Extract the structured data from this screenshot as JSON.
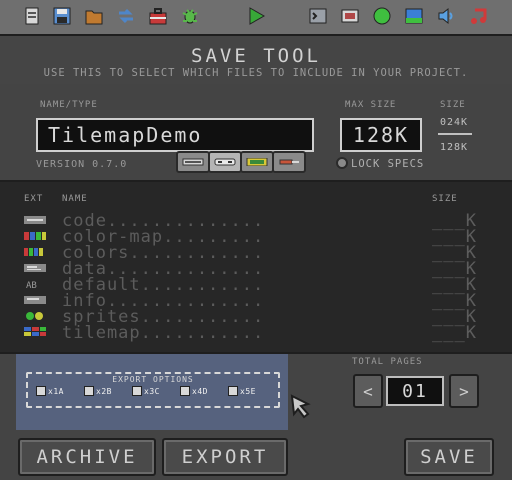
{
  "toolbar": {
    "buttons": [
      {
        "name": "new-file-icon",
        "color": "#d8d8d8"
      },
      {
        "name": "save-disk-icon",
        "color": "#5a8fd0"
      },
      {
        "name": "folder-icon",
        "color": "#c07a30"
      },
      {
        "name": "swap-icon",
        "color": "#4f86c8"
      },
      {
        "name": "toolbox-icon",
        "color": "#c83a3a"
      },
      {
        "name": "bug-icon",
        "color": "#58b84a"
      },
      {
        "name": "play-icon",
        "color": "#38a838"
      },
      {
        "name": "terminal-icon",
        "color": "#9aa0a8"
      },
      {
        "name": "tile-editor-icon",
        "color": "#b04848"
      },
      {
        "name": "sprite-icon",
        "color": "#3fbf3f"
      },
      {
        "name": "map-icon",
        "color": "#3b7fd6"
      },
      {
        "name": "sound-icon",
        "color": "#5aa0e0"
      },
      {
        "name": "music-icon",
        "color": "#d03a3a"
      }
    ]
  },
  "header": {
    "title": "SAVE TOOL",
    "subtitle": "USE THIS TO SELECT WHICH FILES TO INCLUDE IN YOUR PROJECT."
  },
  "project": {
    "name_label": "NAME/TYPE",
    "name_value": "TilemapDemo",
    "version": "VERSION 0.7.0",
    "max_size_label": "MAX SIZE",
    "max_size_value": "128K",
    "lock_specs": "LOCK SPECS",
    "size_label": "SIZE",
    "size_used": "024K",
    "size_total": "128K",
    "type_icons": [
      "console-icon",
      "controller-icon",
      "cartridge-icon",
      "chip-icon"
    ]
  },
  "filelist": {
    "col_ext": "EXT",
    "col_name": "NAME",
    "col_size": "SIZE",
    "rows": [
      {
        "name": "code..............",
        "size": "___K",
        "ext_icon": "code-file-icon"
      },
      {
        "name": "color-map.........",
        "size": "___K",
        "ext_icon": "colormap-file-icon"
      },
      {
        "name": "colors............",
        "size": "___K",
        "ext_icon": "colors-file-icon"
      },
      {
        "name": "data..............",
        "size": "___K",
        "ext_icon": "data-file-icon"
      },
      {
        "name": "default...........",
        "size": "___K",
        "ext_icon": "default-file-icon"
      },
      {
        "name": "info..............",
        "size": "___K",
        "ext_icon": "info-file-icon"
      },
      {
        "name": "sprites...........",
        "size": "___K",
        "ext_icon": "sprites-file-icon"
      },
      {
        "name": "tilemap...........",
        "size": "___K",
        "ext_icon": "tilemap-file-icon"
      }
    ]
  },
  "export": {
    "title": "EXPORT OPTIONS",
    "options": [
      "x1A",
      "x2B",
      "x3C",
      "x4D",
      "x5E"
    ]
  },
  "pages": {
    "label": "TOTAL PAGES",
    "value": "01",
    "prev": "<",
    "next": ">"
  },
  "buttons": {
    "archive": "ARCHIVE",
    "export": "EXPORT",
    "save": "SAVE"
  },
  "colors": {
    "accent_panel": "#56627e",
    "file_text": "#5c5c5c"
  }
}
